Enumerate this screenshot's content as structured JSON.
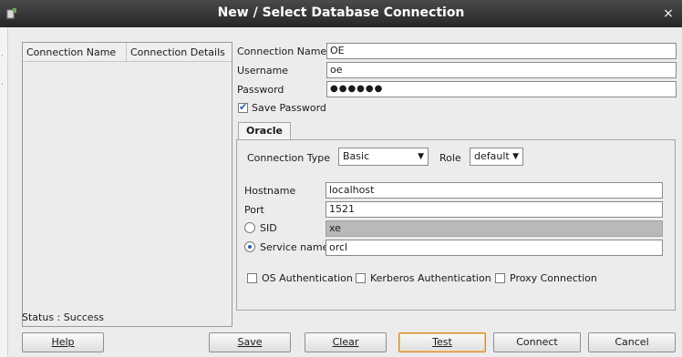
{
  "window": {
    "title": "New / Select Database Connection",
    "close_glyph": "×"
  },
  "connections_table": {
    "headers": [
      "Connection Name",
      "Connection Details"
    ],
    "rows": []
  },
  "form": {
    "connection_name": {
      "label": "Connection Name",
      "value": "OE"
    },
    "username": {
      "label": "Username",
      "value": "oe"
    },
    "password": {
      "label": "Password",
      "value": "●●●●●●"
    },
    "save_password": {
      "label": "Save Password",
      "checked": true
    }
  },
  "tabs": [
    {
      "label": "Oracle",
      "active": true
    }
  ],
  "oracle": {
    "connection_type": {
      "label": "Connection Type",
      "value": "Basic"
    },
    "role": {
      "label": "Role",
      "value": "default"
    },
    "hostname": {
      "label": "Hostname",
      "value": "localhost"
    },
    "port": {
      "label": "Port",
      "value": "1521"
    },
    "sid": {
      "label": "SID",
      "value": "xe",
      "selected": false,
      "disabled": true
    },
    "service_name": {
      "label": "Service name",
      "value": "orcl",
      "selected": true
    },
    "options": [
      {
        "label": "OS Authentication",
        "checked": false
      },
      {
        "label": "Kerberos Authentication",
        "checked": false
      },
      {
        "label": "Proxy Connection",
        "checked": false
      }
    ]
  },
  "status": "Status : Success",
  "buttons": {
    "help": "Help",
    "save": "Save",
    "clear": "Clear",
    "test": "Test",
    "connect": "Connect",
    "cancel": "Cancel"
  },
  "colors": {
    "titlebar": "#2f2f2f",
    "accent": "#2a5fb0",
    "focus_border": "#d38a2a"
  }
}
